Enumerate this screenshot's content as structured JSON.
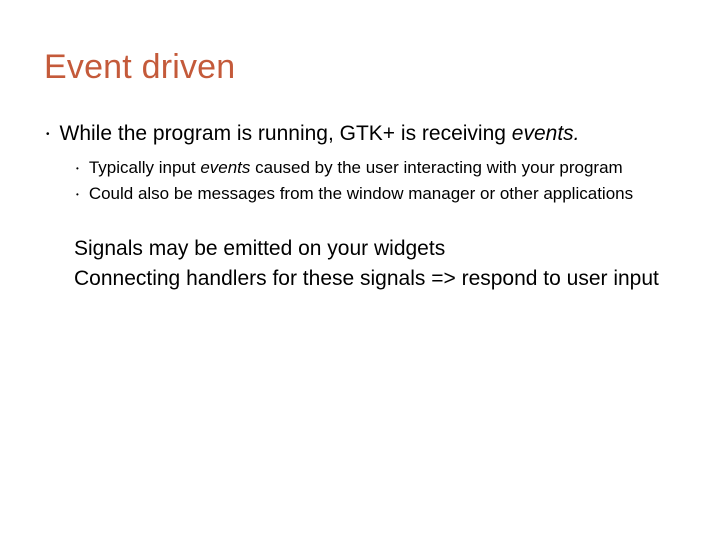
{
  "title": "Event driven",
  "bullets": {
    "l1_a_pre": "While the program is running, GTK+ is receiving ",
    "l1_a_em": "events.",
    "l2_a_pre": "Typically input ",
    "l2_a_em": "events",
    "l2_a_post": " caused by the user interacting with your program",
    "l2_b": "Could also be messages from the window manager or other applications"
  },
  "paras": {
    "p1": "Signals may be emitted on your widgets",
    "p2": "Connecting handlers for these signals => respond to user input"
  }
}
